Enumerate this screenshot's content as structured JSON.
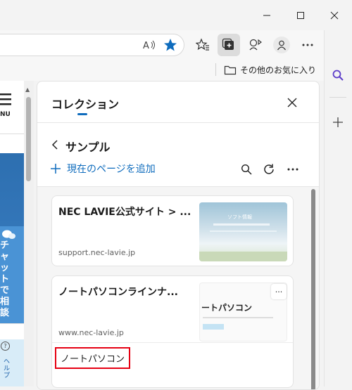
{
  "favorites_bar": {
    "other_favorites": "その他のお気に入り"
  },
  "page": {
    "menu_label": "NU",
    "chat_text": "チャットで相談",
    "help_glyph": "?",
    "side_text": "ヘルプ"
  },
  "collections_panel": {
    "title": "コレクション",
    "collection_name": "サンプル",
    "add_current_page": "現在のページを追加",
    "items": [
      {
        "title": "NEC LAVIE公式サイト > ...",
        "url": "support.nec-lavie.jp",
        "thumbnail_text": "ソフト情報"
      },
      {
        "title": "ノートパソコンラインナ...",
        "url": "www.nec-lavie.jp",
        "thumbnail_text": "ートパソコン",
        "note": "ノートパソコン",
        "more_label": "···"
      }
    ]
  },
  "colors": {
    "accent": "#0f6cbd",
    "highlight_box": "#e60012",
    "favorite_star": "#0f6cbd"
  },
  "icons": [
    "minimize-icon",
    "maximize-icon",
    "close-icon",
    "read-aloud-icon",
    "favorite-star-icon",
    "favorites-icon",
    "collections-icon",
    "browser-essentials-icon",
    "profile-icon",
    "more-icon",
    "copilot-icon",
    "folder-icon",
    "search-icon",
    "add-icon",
    "back-icon",
    "refresh-icon"
  ]
}
